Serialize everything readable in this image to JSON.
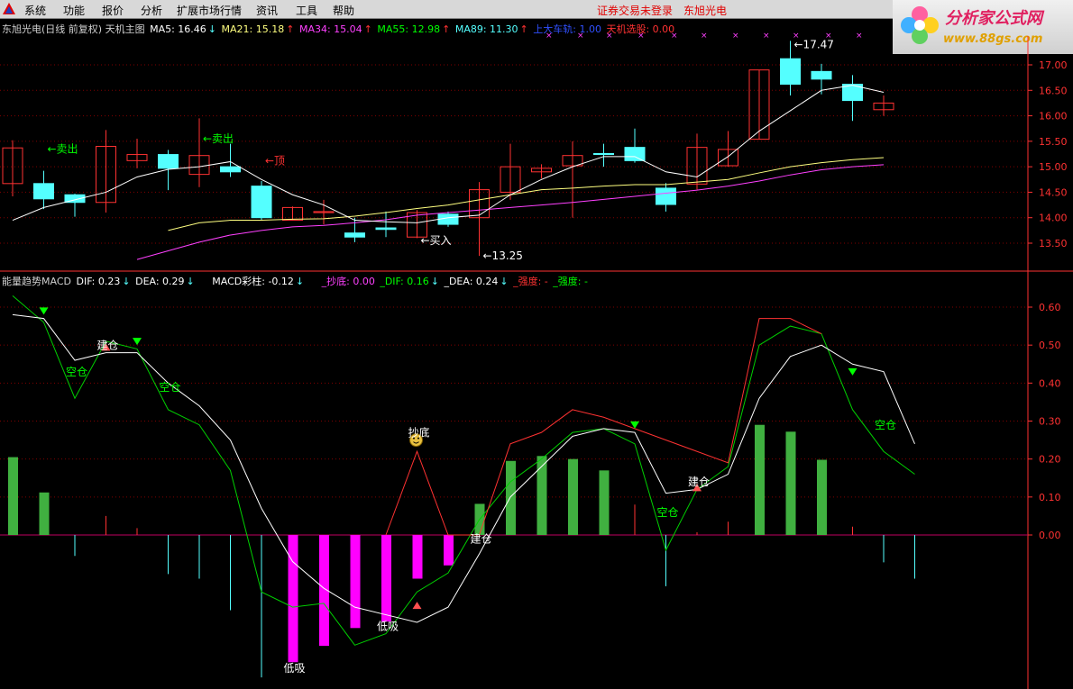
{
  "menu": {
    "items": [
      "系统",
      "功能",
      "报价",
      "分析",
      "扩展市场行情",
      "资讯",
      "工具",
      "帮助"
    ],
    "warning": "证券交易未登录",
    "stock": "东旭光电"
  },
  "brand": {
    "name": "分析家公式网",
    "url": "www.88gs.com"
  },
  "main_legend": {
    "title": "东旭光电(日线 前复权) 天机主图",
    "ma5": "MA5: 16.46",
    "ma21": "MA21: 15.18",
    "ma34": "MA34: 15.04",
    "ma55": "MA55: 12.98",
    "ma89": "MA89: 11.30",
    "rail": "上大车轨: 1.00",
    "pick": "天机选股: 0.00",
    "arrows": {
      "ma5": "↓",
      "ma21": "↑",
      "ma34": "↑",
      "ma55": "↑",
      "ma89": "↑"
    }
  },
  "sub_legend": {
    "title": "能量趋势MACD",
    "dif": "DIF: 0.23",
    "dea": "DEA: 0.29",
    "bar": "MACD彩柱: -0.12",
    "chaodi": "_抄底: 0.00",
    "dif2": "_DIF: 0.16",
    "dea2": "_DEA: 0.24",
    "strong1": "_强度: -",
    "strong2": "_强度: -"
  },
  "colors": {
    "up": "#ff3232",
    "down": "#54ffff",
    "ma5": "#ffffff",
    "ma21": "#ffff80",
    "ma34": "#ff40ff",
    "buy": "#00ff00",
    "grid": "#800000",
    "axis": "#ff3232"
  },
  "price_axis": {
    "labels": [
      "17.00",
      "16.50",
      "16.00",
      "15.50",
      "15.00",
      "14.50",
      "14.00",
      "13.50"
    ]
  },
  "macd_axis": {
    "labels": [
      "0.60",
      "0.50",
      "0.40",
      "0.30",
      "0.20",
      "0.10",
      "0.00"
    ]
  },
  "chart_data": [
    {
      "type": "candlestick",
      "title": "东旭光电(日线 前复权) 天机主图",
      "ylim": [
        13.0,
        17.3
      ],
      "candles": [
        {
          "o": 14.67,
          "c": 15.37,
          "h": 15.52,
          "l": 14.42
        },
        {
          "o": 14.67,
          "c": 14.37,
          "h": 14.92,
          "l": 14.17
        },
        {
          "o": 14.45,
          "c": 14.3,
          "h": 14.47,
          "l": 14.02
        },
        {
          "o": 14.3,
          "c": 15.4,
          "h": 15.72,
          "l": 14.1
        },
        {
          "o": 15.12,
          "c": 15.24,
          "h": 15.55,
          "l": 14.97
        },
        {
          "o": 15.24,
          "c": 14.97,
          "h": 15.33,
          "l": 14.54
        },
        {
          "o": 14.85,
          "c": 15.22,
          "h": 15.95,
          "l": 14.6
        },
        {
          "o": 15.0,
          "c": 14.9,
          "h": 15.45,
          "l": 14.8
        },
        {
          "o": 14.62,
          "c": 14.0,
          "h": 14.72,
          "l": 13.95
        },
        {
          "o": 13.95,
          "c": 14.2,
          "h": 14.22,
          "l": 13.95
        },
        {
          "o": 14.1,
          "c": 14.12,
          "h": 14.35,
          "l": 13.87
        },
        {
          "o": 13.7,
          "c": 13.62,
          "h": 14.0,
          "l": 13.52
        },
        {
          "o": 13.8,
          "c": 13.77,
          "h": 14.12,
          "l": 13.62
        },
        {
          "o": 13.62,
          "c": 14.1,
          "h": 14.15,
          "l": 13.6
        },
        {
          "o": 14.07,
          "c": 13.87,
          "h": 14.12,
          "l": 13.82
        },
        {
          "o": 14.0,
          "c": 14.55,
          "h": 14.7,
          "l": 13.25
        },
        {
          "o": 14.5,
          "c": 15.0,
          "h": 15.45,
          "l": 14.35
        },
        {
          "o": 14.9,
          "c": 14.97,
          "h": 15.05,
          "l": 14.77
        },
        {
          "o": 15.02,
          "c": 15.22,
          "h": 15.5,
          "l": 14.0
        },
        {
          "o": 15.26,
          "c": 15.24,
          "h": 15.45,
          "l": 15.0
        },
        {
          "o": 15.38,
          "c": 15.12,
          "h": 15.75,
          "l": 15.08
        },
        {
          "o": 14.58,
          "c": 14.26,
          "h": 14.68,
          "l": 14.12
        },
        {
          "o": 14.66,
          "c": 15.38,
          "h": 15.65,
          "l": 14.55
        },
        {
          "o": 15.02,
          "c": 15.34,
          "h": 15.7,
          "l": 15.0
        },
        {
          "o": 15.54,
          "c": 16.9,
          "h": 16.9,
          "l": 15.54
        },
        {
          "o": 17.12,
          "c": 16.62,
          "h": 17.47,
          "l": 16.4
        },
        {
          "o": 16.87,
          "c": 16.72,
          "h": 17.02,
          "l": 16.42
        },
        {
          "o": 16.62,
          "c": 16.3,
          "h": 16.8,
          "l": 15.9
        },
        {
          "o": 16.12,
          "c": 16.25,
          "h": 16.4,
          "l": 16.0
        }
      ],
      "ma5": [
        13.95,
        14.2,
        14.35,
        14.5,
        14.8,
        14.95,
        15.0,
        15.1,
        14.75,
        14.45,
        14.25,
        13.95,
        13.92,
        13.9,
        14.0,
        14.05,
        14.45,
        14.75,
        15.0,
        15.2,
        15.2,
        14.9,
        14.8,
        15.2,
        15.7,
        16.1,
        16.5,
        16.6,
        16.46
      ],
      "ma21": [
        null,
        null,
        null,
        null,
        null,
        13.75,
        13.9,
        13.95,
        13.95,
        13.97,
        13.98,
        14.03,
        14.1,
        14.18,
        14.25,
        14.35,
        14.45,
        14.55,
        14.58,
        14.62,
        14.65,
        14.65,
        14.7,
        14.75,
        14.88,
        15.0,
        15.08,
        15.14,
        15.18
      ],
      "ma34": [
        null,
        null,
        null,
        null,
        13.18,
        13.35,
        13.52,
        13.66,
        13.75,
        13.82,
        13.85,
        13.9,
        13.96,
        14.05,
        14.1,
        14.15,
        14.2,
        14.25,
        14.3,
        14.36,
        14.42,
        14.48,
        14.54,
        14.62,
        14.72,
        14.84,
        14.94,
        15.0,
        15.04
      ],
      "annotations": [
        {
          "i": 1,
          "text": "←卖出",
          "at": 15.35
        },
        {
          "i": 6,
          "text": "←卖出",
          "at": 15.55
        },
        {
          "i": 8,
          "text": "←顶",
          "at": 15.12
        },
        {
          "i": 13,
          "text": "←买入",
          "at": 13.55
        },
        {
          "i": 15,
          "text": "←13.25",
          "at": 13.25
        },
        {
          "i": 25,
          "text": "←17.47",
          "at": 17.4
        }
      ]
    },
    {
      "type": "macd",
      "title": "能量趋势MACD",
      "ylim": [
        -0.38,
        0.63
      ],
      "white": [
        0.58,
        0.57,
        0.46,
        0.48,
        0.48,
        0.4,
        0.34,
        0.25,
        0.07,
        -0.07,
        -0.14,
        -0.19,
        -0.21,
        -0.23,
        -0.19,
        -0.05,
        0.1,
        0.18,
        0.26,
        0.28,
        0.27,
        0.11,
        0.12,
        0.16,
        0.36,
        0.47,
        0.5,
        0.45,
        0.43,
        0.24
      ],
      "green": [
        0.63,
        0.56,
        0.36,
        0.51,
        0.49,
        0.33,
        0.29,
        0.17,
        -0.15,
        -0.19,
        -0.18,
        -0.29,
        -0.26,
        -0.15,
        -0.1,
        0.04,
        0.14,
        0.2,
        0.27,
        0.28,
        0.24,
        -0.04,
        0.12,
        0.18,
        0.5,
        0.55,
        0.53,
        0.33,
        0.22,
        0.16
      ],
      "red": [
        null,
        null,
        null,
        null,
        null,
        null,
        null,
        null,
        null,
        null,
        null,
        null,
        0.0,
        0.22,
        0.0,
        0.0,
        0.24,
        0.27,
        0.33,
        0.31,
        null,
        null,
        null,
        0.19,
        0.57,
        0.57,
        0.53,
        null,
        null,
        null
      ],
      "red_span": [
        12,
        26
      ],
      "hist": [
        0.205,
        0.112,
        -0.055,
        0.05,
        0.018,
        -0.103,
        -0.115,
        -0.198,
        -0.375,
        -0.335,
        -0.292,
        -0.245,
        -0.228,
        -0.115,
        -0.08,
        0.082,
        0.195,
        0.208,
        0.2,
        0.17,
        0.08,
        -0.135,
        0.007,
        0.035,
        0.29,
        0.272,
        0.198,
        0.022,
        -0.072,
        -0.115
      ],
      "labels": [
        {
          "i": 2,
          "text": "空仓",
          "v": 0.42,
          "color": "green"
        },
        {
          "i": 3,
          "text": "建仓",
          "v": 0.49,
          "color": "white"
        },
        {
          "i": 5,
          "text": "空仓",
          "v": 0.38,
          "color": "green"
        },
        {
          "i": 9,
          "text": "低吸",
          "v": -0.36,
          "color": "white"
        },
        {
          "i": 12,
          "text": "低吸",
          "v": -0.25,
          "color": "white"
        },
        {
          "i": 13,
          "text": "抄底",
          "v": 0.26,
          "color": "white"
        },
        {
          "i": 15,
          "text": "建仓",
          "v": -0.02,
          "color": "white"
        },
        {
          "i": 21,
          "text": "空仓",
          "v": 0.05,
          "color": "green"
        },
        {
          "i": 22,
          "text": "建仓",
          "v": 0.13,
          "color": "white"
        },
        {
          "i": 28,
          "text": "空仓",
          "v": 0.28,
          "color": "green"
        }
      ]
    }
  ]
}
